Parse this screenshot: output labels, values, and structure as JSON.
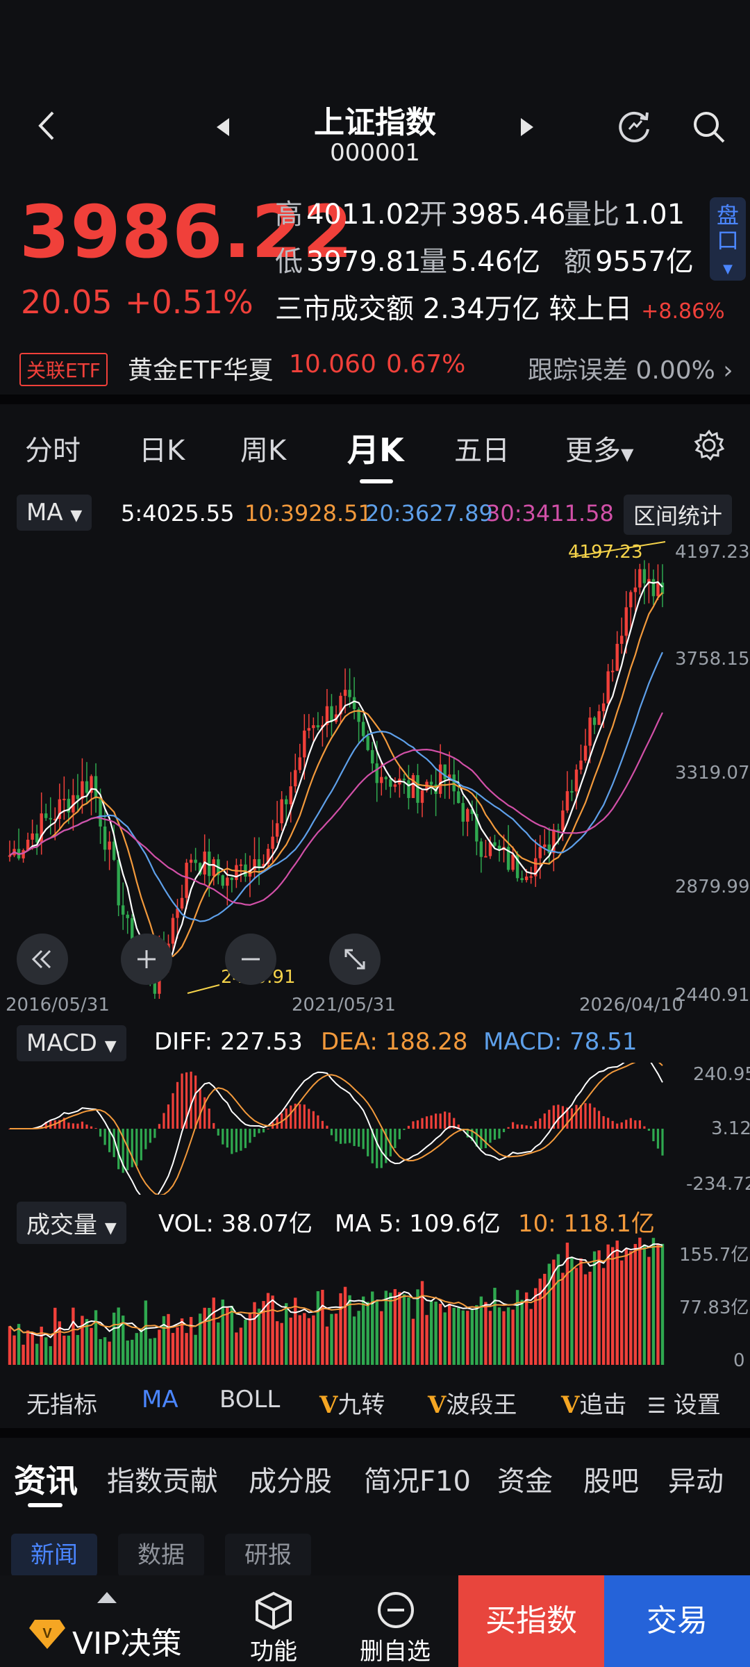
{
  "header": {
    "title": "上证指数",
    "code": "000001"
  },
  "quote": {
    "price": "3986.22",
    "change": "20.05",
    "change_pct": "+0.51%",
    "high_label": "高",
    "high": "4011.02",
    "open_label": "开",
    "open": "3985.46",
    "ratio_label": "量比",
    "ratio": "1.01",
    "low_label": "低",
    "low": "3979.81",
    "vol_label": "量",
    "vol": "5.46亿",
    "amt_label": "额",
    "amt": "9557亿",
    "turnover_text": "三市成交额 2.34万亿 较上日",
    "turnover_chg": "+8.86%",
    "pankou": "盘口"
  },
  "etf": {
    "tag": "关联ETF",
    "name": "黄金ETF华夏",
    "price": "10.060",
    "pct": "0.67%",
    "err_label": "跟踪误差",
    "err": "0.00%"
  },
  "period_tabs": [
    "分时",
    "日K",
    "周K",
    "月K",
    "五日",
    "更多"
  ],
  "active_period": "月K",
  "ma_bar": {
    "selector": "MA",
    "ma5": "5:4025.55",
    "ma10": "10:3928.51",
    "ma20": "20:3627.89",
    "ma30": "30:3411.58",
    "range_btn": "区间统计"
  },
  "kline": {
    "y_labels": [
      "4197.23",
      "3758.15",
      "3319.07",
      "2879.99",
      "2440.91"
    ],
    "x_labels": [
      "2016/05/31",
      "2021/05/31",
      "2026/04/10"
    ],
    "max_marker": "4197.23",
    "min_marker": "2440.91"
  },
  "macd": {
    "selector": "MACD",
    "diff": "DIFF: 227.53",
    "dea": "DEA: 188.28",
    "macd": "MACD: 78.51",
    "y_labels": [
      "240.95",
      "3.12",
      "-234.72"
    ]
  },
  "volume": {
    "selector": "成交量",
    "vol": "VOL: 38.07亿",
    "ma5": "MA 5: 109.6亿",
    "ma10": "10: 118.1亿",
    "y_labels": [
      "155.7亿",
      "77.83亿",
      "0"
    ]
  },
  "indicators": [
    "无指标",
    "MA",
    "BOLL",
    "九转",
    "波段王",
    "追击",
    "设置"
  ],
  "info_tabs": [
    "资讯",
    "指数贡献",
    "成分股",
    "简况F10",
    "资金",
    "股吧",
    "异动"
  ],
  "sub_tabs": [
    "新闻",
    "数据",
    "研报"
  ],
  "bottom": {
    "vip": "VIP决策",
    "func": "功能",
    "remove": "删自选",
    "buy": "买指数",
    "trade": "交易"
  },
  "colors": {
    "up": "#f0403a",
    "down": "#2fa84f",
    "ma5": "#ffffff",
    "ma10": "#f39a3c",
    "ma20": "#5ea0ea",
    "ma30": "#d250a8",
    "accent": "#4b86ff"
  },
  "chart_data": {
    "type": "line",
    "title": "上证指数 月K",
    "x": [
      "2016/05/31",
      "2021/05/31",
      "2026/04/10"
    ],
    "ylim": [
      2440.91,
      4197.23
    ],
    "series": [
      {
        "name": "MA5",
        "last": 4025.55
      },
      {
        "name": "MA10",
        "last": 3928.51
      },
      {
        "name": "MA20",
        "last": 3627.89
      },
      {
        "name": "MA30",
        "last": 3411.58
      }
    ]
  }
}
